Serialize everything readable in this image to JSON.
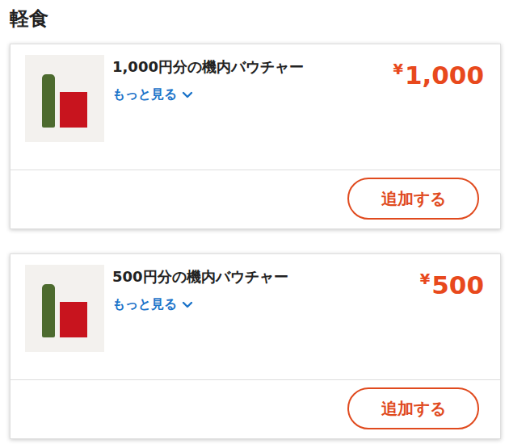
{
  "section": {
    "title": "軽食"
  },
  "items": [
    {
      "title": "1,000円分の機内バウチャー",
      "more": "もっと見る",
      "currency": "¥",
      "amount": "1,000",
      "button": "追加する"
    },
    {
      "title": "500円分の機内バウチャー",
      "more": "もっと見る",
      "currency": "¥",
      "amount": "500",
      "button": "追加する"
    }
  ]
}
